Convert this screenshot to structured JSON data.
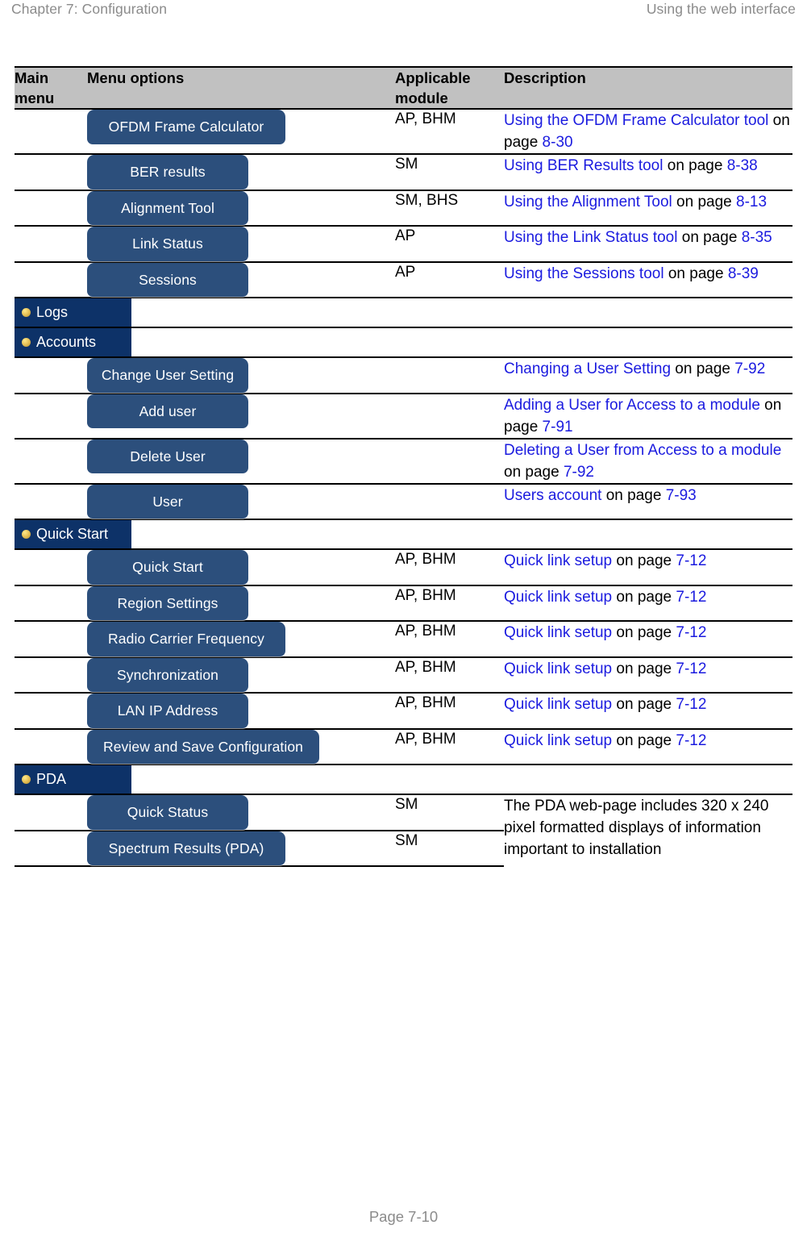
{
  "runhead": {
    "left": "Chapter 7:  Configuration",
    "right": "Using the web interface"
  },
  "table": {
    "headers": {
      "main_menu": "Main menu",
      "menu_options": "Menu options",
      "applicable_module": "Applicable module",
      "description": "Description"
    },
    "rows": [
      {
        "kind": "option",
        "button": "OFDM Frame Calculator",
        "module": "AP, BHM",
        "desc_link": "Using the OFDM Frame Calculator tool",
        "desc_mid": " on page ",
        "desc_page": "8-30"
      },
      {
        "kind": "option",
        "button": "BER results",
        "module": "SM",
        "desc_link": "Using BER Results tool",
        "desc_mid": " on page ",
        "desc_page": "8-38"
      },
      {
        "kind": "option",
        "button": "Alignment Tool",
        "module": "SM, BHS",
        "desc_link": "Using the Alignment Tool",
        "desc_mid": " on page ",
        "desc_page": "8-13"
      },
      {
        "kind": "option",
        "button": "Link Status",
        "module": "AP",
        "desc_link": "Using the Link Status tool",
        "desc_mid": " on page ",
        "desc_page": "8-35"
      },
      {
        "kind": "option",
        "button": "Sessions",
        "module": "AP",
        "desc_link": "Using the Sessions tool",
        "desc_mid": " on page ",
        "desc_page": "8-39"
      },
      {
        "kind": "mainmenu",
        "tab": "Logs",
        "module": "",
        "desc_link": "",
        "desc_mid": "",
        "desc_page": ""
      },
      {
        "kind": "mainmenu",
        "tab": "Accounts",
        "module": "",
        "desc_link": "",
        "desc_mid": "",
        "desc_page": ""
      },
      {
        "kind": "option",
        "button": "Change User Setting",
        "module": "",
        "desc_link": "Changing a User Setting",
        "desc_mid": " on page ",
        "desc_page": "7-92"
      },
      {
        "kind": "option",
        "button": "Add user",
        "module": "",
        "desc_link": "Adding a User for Access to a module",
        "desc_mid": " on page ",
        "desc_page": "7-91"
      },
      {
        "kind": "option",
        "button": "Delete User",
        "module": "",
        "desc_link": "Deleting a User from Access to a module",
        "desc_mid": " on page ",
        "desc_page": "7-92"
      },
      {
        "kind": "option",
        "button": "User",
        "module": "",
        "desc_link": "Users account",
        "desc_mid": " on page ",
        "desc_page": "7-93"
      },
      {
        "kind": "mainmenu",
        "tab": "Quick Start",
        "module": "",
        "desc_link": "",
        "desc_mid": "",
        "desc_page": ""
      },
      {
        "kind": "option",
        "button": "Quick Start",
        "module": "AP, BHM",
        "desc_link": "Quick link setup",
        "desc_mid": " on page ",
        "desc_page": "7-12"
      },
      {
        "kind": "option",
        "button": "Region Settings",
        "module": "AP, BHM",
        "desc_link": "Quick link setup",
        "desc_mid": " on page ",
        "desc_page": "7-12"
      },
      {
        "kind": "option",
        "button": "Radio Carrier Frequency",
        "module": "AP, BHM",
        "desc_link": "Quick link setup",
        "desc_mid": " on page ",
        "desc_page": "7-12"
      },
      {
        "kind": "option",
        "button": "Synchronization",
        "module": "AP, BHM",
        "desc_link": "Quick link setup",
        "desc_mid": " on page ",
        "desc_page": "7-12"
      },
      {
        "kind": "option",
        "button": "LAN IP Address",
        "module": "AP, BHM",
        "desc_link": "Quick link setup",
        "desc_mid": " on page ",
        "desc_page": "7-12"
      },
      {
        "kind": "option",
        "button": "Review and Save Configuration",
        "module": "AP, BHM",
        "desc_link": "Quick link setup",
        "desc_mid": " on page ",
        "desc_page": "7-12"
      },
      {
        "kind": "mainmenu",
        "tab": "PDA",
        "module": "",
        "desc_link": "",
        "desc_mid": "",
        "desc_page": ""
      },
      {
        "kind": "option",
        "button": "Quick Status",
        "module": "SM",
        "desc_link": "",
        "desc_mid": "",
        "desc_page": ""
      },
      {
        "kind": "option",
        "button": "Spectrum Results (PDA)",
        "module": "SM",
        "desc_link": "",
        "desc_mid": "",
        "desc_page": ""
      }
    ],
    "pda_merged_description": "The PDA web-page includes 320 x 240 pixel formatted displays of information important to installation"
  },
  "footer": {
    "page_label": "Page 7-10"
  },
  "colors": {
    "header_band": "#c1c1c1",
    "button_navy": "#2c4f7c",
    "mainmenu_navy": "#0d3268",
    "link_blue": "#1b1bdf",
    "runhead_gray": "#8b8b8b",
    "bullet_gold": "#e8c45a"
  },
  "icons": {
    "main_menu_bullet": "gold-ball-icon"
  }
}
